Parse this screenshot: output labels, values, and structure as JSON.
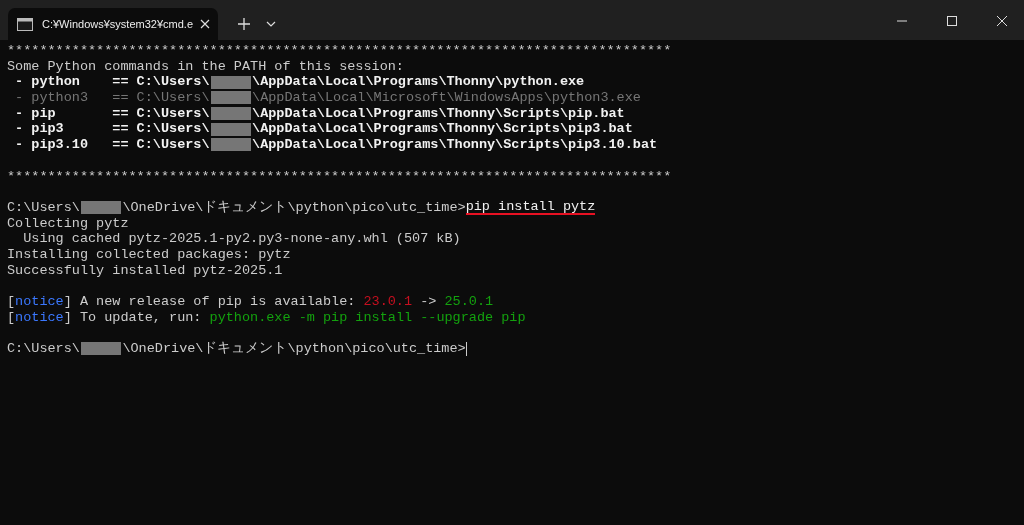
{
  "tabs": [
    {
      "title": "C:¥Windows¥system32¥cmd.e",
      "selected": true
    }
  ],
  "terminal": {
    "lines": [
      {
        "kind": "text",
        "segments": [
          {
            "kind": "normal",
            "text": "**********************************************************************************"
          }
        ]
      },
      {
        "kind": "text",
        "segments": [
          {
            "kind": "normal",
            "text": "Some Python commands in the PATH of this session:"
          }
        ]
      },
      {
        "kind": "text",
        "segments": [
          {
            "kind": "bright",
            "text": " - python    == C:\\Users\\"
          },
          {
            "kind": "redacted"
          },
          {
            "kind": "bright",
            "text": "\\AppData\\Local\\Programs\\Thonny\\python.exe"
          }
        ]
      },
      {
        "kind": "text",
        "segments": [
          {
            "kind": "dim",
            "text": " - python3   == C:\\Users\\"
          },
          {
            "kind": "redacted"
          },
          {
            "kind": "dim",
            "text": "\\AppData\\Local\\Microsoft\\WindowsApps\\python3.exe"
          }
        ]
      },
      {
        "kind": "text",
        "segments": [
          {
            "kind": "bright",
            "text": " - pip       == C:\\Users\\"
          },
          {
            "kind": "redacted"
          },
          {
            "kind": "bright",
            "text": "\\AppData\\Local\\Programs\\Thonny\\Scripts\\pip.bat"
          }
        ]
      },
      {
        "kind": "text",
        "segments": [
          {
            "kind": "bright",
            "text": " - pip3      == C:\\Users\\"
          },
          {
            "kind": "redacted"
          },
          {
            "kind": "bright",
            "text": "\\AppData\\Local\\Programs\\Thonny\\Scripts\\pip3.bat"
          }
        ]
      },
      {
        "kind": "text",
        "segments": [
          {
            "kind": "bright",
            "text": " - pip3.10   == C:\\Users\\"
          },
          {
            "kind": "redacted"
          },
          {
            "kind": "bright",
            "text": "\\AppData\\Local\\Programs\\Thonny\\Scripts\\pip3.10.bat"
          }
        ]
      },
      {
        "kind": "blank"
      },
      {
        "kind": "text",
        "segments": [
          {
            "kind": "normal",
            "text": "**********************************************************************************"
          }
        ]
      },
      {
        "kind": "blank"
      },
      {
        "kind": "text",
        "segments": [
          {
            "kind": "normal",
            "text": "C:\\Users\\"
          },
          {
            "kind": "redacted"
          },
          {
            "kind": "normal",
            "text": "\\OneDrive\\ドキュメント\\python\\pico\\utc_time>"
          },
          {
            "kind": "command",
            "text": "pip install pytz"
          }
        ]
      },
      {
        "kind": "text",
        "segments": [
          {
            "kind": "normal",
            "text": "Collecting pytz"
          }
        ]
      },
      {
        "kind": "text",
        "segments": [
          {
            "kind": "normal",
            "text": "  Using cached pytz-2025.1-py2.py3-none-any.whl (507 kB)"
          }
        ]
      },
      {
        "kind": "text",
        "segments": [
          {
            "kind": "normal",
            "text": "Installing collected packages: pytz"
          }
        ]
      },
      {
        "kind": "text",
        "segments": [
          {
            "kind": "normal",
            "text": "Successfully installed pytz-2025.1"
          }
        ]
      },
      {
        "kind": "blank"
      },
      {
        "kind": "text",
        "segments": [
          {
            "kind": "normal",
            "text": "["
          },
          {
            "kind": "notice",
            "text": "notice"
          },
          {
            "kind": "normal",
            "text": "] A new release of pip is available: "
          },
          {
            "kind": "old",
            "text": "23.0.1"
          },
          {
            "kind": "normal",
            "text": " -> "
          },
          {
            "kind": "new",
            "text": "25.0.1"
          }
        ]
      },
      {
        "kind": "text",
        "segments": [
          {
            "kind": "normal",
            "text": "["
          },
          {
            "kind": "notice",
            "text": "notice"
          },
          {
            "kind": "normal",
            "text": "] To update, run: "
          },
          {
            "kind": "new",
            "text": "python.exe -m pip install --upgrade pip"
          }
        ]
      },
      {
        "kind": "blank"
      },
      {
        "kind": "text",
        "cursor": true,
        "segments": [
          {
            "kind": "normal",
            "text": "C:\\Users\\"
          },
          {
            "kind": "redacted"
          },
          {
            "kind": "normal",
            "text": "\\OneDrive\\ドキュメント\\python\\pico\\utc_time>"
          }
        ]
      }
    ]
  }
}
